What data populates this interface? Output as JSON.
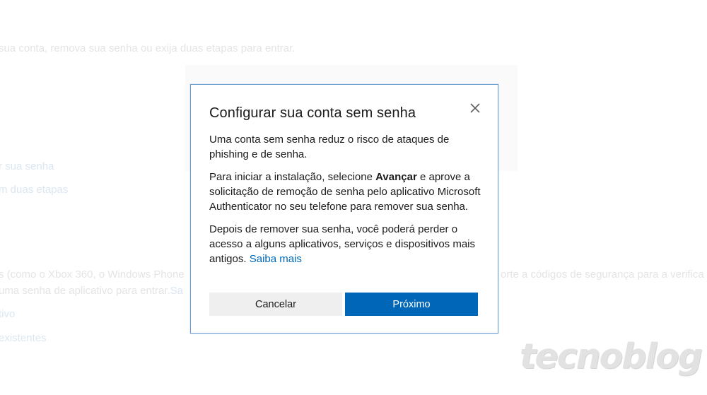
{
  "background": {
    "line1": "sua conta, remova sua senha ou exija duas etapas para entrar.",
    "link1": "r sua senha",
    "link2": "m duas etapas",
    "line_left": "s (como o Xbox 360, o Windows Phone",
    "line_right": "orte a códigos de segurança para a verifica",
    "line3": " uma senha de aplicativo para entrar.",
    "line3_link": "Sa",
    "line4": "tivo",
    "line5": "existentes"
  },
  "dialog": {
    "title": "Configurar sua conta sem senha",
    "paragraph1": "Uma conta sem senha reduz o risco de ataques de phishing e de senha.",
    "paragraph2_prefix": "Para iniciar a instalação, selecione ",
    "paragraph2_bold": "Avançar",
    "paragraph2_suffix": " e aprove a solicitação de remoção de senha pelo aplicativo Microsoft Authenticator no seu telefone para remover sua senha.",
    "paragraph3": "Depois de remover sua senha, você poderá perder o acesso a alguns aplicativos, serviços e dispositivos mais antigos. ",
    "learn_more_link": "Saiba mais",
    "cancel_label": "Cancelar",
    "next_label": "Próximo"
  },
  "icons": {
    "close": "close-icon"
  },
  "colors": {
    "accent": "#0067b8",
    "dialog_border": "#6a9bcf",
    "cancel_bg": "#efefef"
  },
  "watermark": "tecnoblog"
}
